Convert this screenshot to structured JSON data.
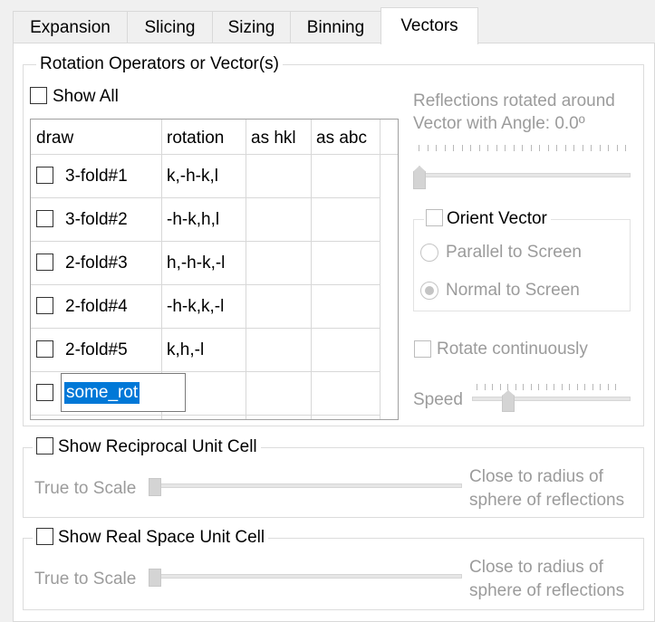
{
  "tabs": [
    "Expansion",
    "Slicing",
    "Sizing",
    "Binning",
    "Vectors"
  ],
  "active_tab": "Vectors",
  "rotation_group": {
    "title": "Rotation Operators or Vector(s)",
    "show_all_label": "Show All",
    "show_all_checked": false
  },
  "table": {
    "headers": [
      "draw",
      "rotation",
      "as hkl",
      "as abc"
    ],
    "rows": [
      {
        "name": "3-fold#1",
        "rotation": "k,-h-k,l",
        "hkl": "",
        "abc": "",
        "checked": false
      },
      {
        "name": "3-fold#2",
        "rotation": "-h-k,h,l",
        "hkl": "",
        "abc": "",
        "checked": false
      },
      {
        "name": "2-fold#3",
        "rotation": "h,-h-k,-l",
        "hkl": "",
        "abc": "",
        "checked": false
      },
      {
        "name": "2-fold#4",
        "rotation": "-h-k,k,-l",
        "hkl": "",
        "abc": "",
        "checked": false
      },
      {
        "name": "2-fold#5",
        "rotation": "k,h,-l",
        "hkl": "",
        "abc": "",
        "checked": false
      }
    ],
    "edit_row": {
      "value": "some_rot",
      "checked": false
    }
  },
  "reflections": {
    "line1": "Reflections rotated around",
    "line2": "Vector with Angle: 0.0º",
    "angle_slider_level": 0
  },
  "orient": {
    "title": "Orient Vector",
    "checked": false,
    "parallel_label": "Parallel to Screen",
    "normal_label": "Normal to Screen",
    "selected": "Normal to Screen"
  },
  "rotate_continuously": {
    "label": "Rotate continuously",
    "checked": false
  },
  "speed": {
    "label": "Speed",
    "level": 0.22
  },
  "reciprocal": {
    "title": "Show Reciprocal Unit Cell",
    "checked": false,
    "left_label": "True to Scale",
    "right_line1": "Close to radius of",
    "right_line2": "sphere of reflections",
    "level": 0
  },
  "realspace": {
    "title": "Show Real Space Unit Cell",
    "checked": false,
    "left_label": "True to Scale",
    "right_line1": "Close to radius of",
    "right_line2": "sphere of reflections",
    "level": 0
  },
  "colors": {
    "selection": "#0078d7",
    "disabled_text": "#9b9b9b"
  }
}
